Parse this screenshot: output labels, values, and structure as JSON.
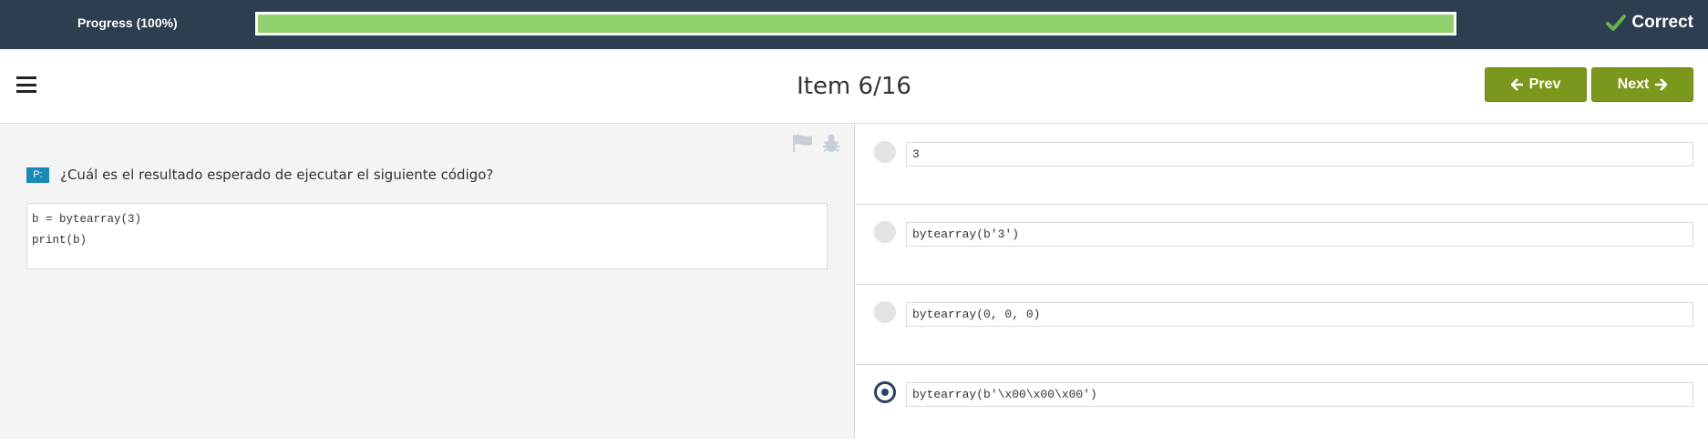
{
  "progress": {
    "label": "Progress (100%)",
    "percent": 100
  },
  "status": {
    "text": "Correct",
    "icon": "check-icon"
  },
  "header": {
    "title": "Item 6/16",
    "prev_label": "Prev",
    "next_label": "Next"
  },
  "question": {
    "badge": "P:",
    "text": "¿Cuál es el resultado esperado de ejecutar el siguiente código?",
    "code": [
      "b = bytearray(3)",
      "print(b)"
    ]
  },
  "options": [
    {
      "text": "3",
      "selected": false
    },
    {
      "text": "bytearray(b'3')",
      "selected": false
    },
    {
      "text": "bytearray(0, 0, 0)",
      "selected": false
    },
    {
      "text": "bytearray(b'\\x00\\x00\\x00')",
      "selected": true
    }
  ],
  "colors": {
    "topbar": "#2d3e50",
    "progress_fill": "#8fd16a",
    "check": "#6ab04c",
    "nav_button": "#7b981c",
    "badge": "#1a8ab5",
    "radio_selected": "#2f3f62"
  }
}
